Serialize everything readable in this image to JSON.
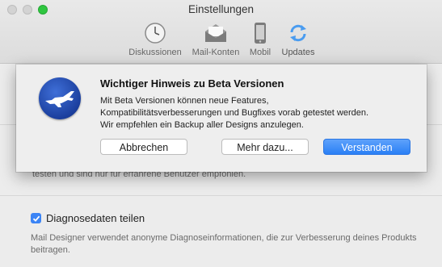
{
  "window": {
    "title": "Einstellungen"
  },
  "toolbar": {
    "items": [
      {
        "label": "Diskussionen",
        "icon": "clock-icon"
      },
      {
        "label": "Mail-Konten",
        "icon": "envelope-icon"
      },
      {
        "label": "Mobil",
        "icon": "phone-icon"
      },
      {
        "label": "Updates",
        "icon": "refresh-icon"
      }
    ]
  },
  "background": {
    "partial_text": "testen und sind nur für erfahrene Benutzer empfohlen.",
    "diagnostics_label": "Diagnosedaten teilen",
    "diagnostics_checked": true,
    "diagnostics_description": "Mail Designer verwendet anonyme Diagnoseinformationen, die zur Verbesserung deines Produkts beitragen."
  },
  "dialog": {
    "title": "Wichtiger Hinweis zu Beta Versionen",
    "message_lines": [
      "Mit Beta Versionen können neue Features,",
      "Kompatibilitätsverbesserungen und Bugfixes vorab getestet werden.",
      "Wir empfehlen ein Backup aller Designs anzulegen."
    ],
    "buttons": {
      "cancel": "Abbrechen",
      "more": "Mehr dazu...",
      "ok": "Verstanden"
    }
  },
  "colors": {
    "accent": "#2a7ff5",
    "app_icon": "#1b3f9e",
    "close_inactive": "#d3d3d3",
    "zoom": "#2fc640"
  }
}
